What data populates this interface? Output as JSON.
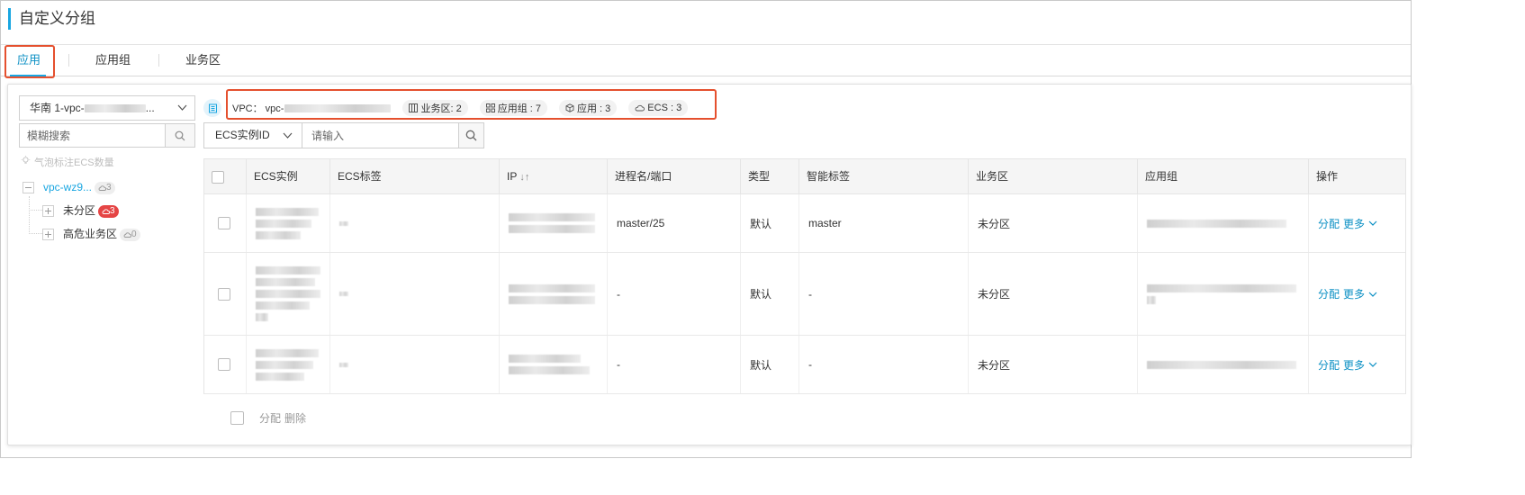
{
  "page": {
    "title": "自定义分组"
  },
  "tabs": [
    {
      "label": "应用",
      "active": true
    },
    {
      "label": "应用组",
      "active": false
    },
    {
      "label": "业务区",
      "active": false
    }
  ],
  "sidebar": {
    "region_prefix": "华南 1-vpc-",
    "region_suffix": "...",
    "search_placeholder": "模糊搜索",
    "hint": "气泡标注ECS数量",
    "tree": {
      "root": {
        "label": "vpc-wz9...",
        "count": "3"
      },
      "children": [
        {
          "label": "未分区",
          "count": "3",
          "alert": true
        },
        {
          "label": "高危业务区",
          "count": "0",
          "alert": false
        }
      ]
    }
  },
  "summary": {
    "vpc_label": "VPC： vpc-",
    "chips": [
      {
        "icon": "business-zone-icon",
        "text": "业务区: 2"
      },
      {
        "icon": "app-group-icon",
        "text": "应用组 : 7"
      },
      {
        "icon": "app-cube-icon",
        "text": "应用 : 3"
      },
      {
        "icon": "ecs-cloud-icon",
        "text": "ECS : 3"
      }
    ]
  },
  "filter": {
    "field": "ECS实例ID",
    "placeholder": "请输入"
  },
  "table": {
    "columns": [
      "ECS实例",
      "ECS标签",
      "IP",
      "进程名/端口",
      "类型",
      "智能标签",
      "业务区",
      "应用组",
      "操作"
    ],
    "rows": [
      {
        "process": "master/25",
        "type": "默认",
        "smart_tag": "master",
        "zone": "未分区",
        "op_assign": "分配",
        "op_more": "更多"
      },
      {
        "process": "-",
        "type": "默认",
        "smart_tag": "-",
        "zone": "未分区",
        "op_assign": "分配",
        "op_more": "更多"
      },
      {
        "process": "-",
        "type": "默认",
        "smart_tag": "-",
        "zone": "未分区",
        "op_assign": "分配",
        "op_more": "更多"
      }
    ]
  },
  "footer": {
    "assign": "分配",
    "delete": "删除"
  },
  "colors": {
    "accent": "#19a6e1",
    "link": "#0c90c4",
    "highlight": "#e5502e",
    "alert": "#e54545"
  }
}
